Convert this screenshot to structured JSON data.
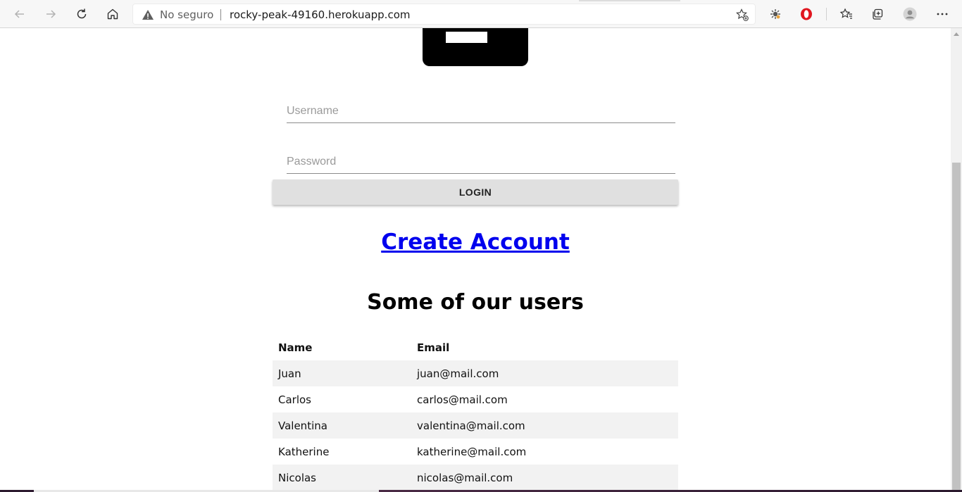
{
  "browser": {
    "security_label": "No seguro",
    "url": "rocky-peak-49160.herokuapp.com",
    "icons": [
      "back-icon",
      "forward-icon",
      "refresh-icon",
      "home-icon",
      "warning-icon",
      "add-favorite-icon",
      "extension-icon",
      "opera-icon",
      "favorites-icon",
      "collections-icon",
      "profile-icon",
      "more-icon"
    ]
  },
  "login": {
    "username_placeholder": "Username",
    "password_placeholder": "Password",
    "button_label": "LOGIN"
  },
  "create_account_label": "Create Account",
  "users_section": {
    "title": "Some of our users",
    "columns": [
      "Name",
      "Email"
    ],
    "rows": [
      {
        "name": "Juan",
        "email": "juan@mail.com"
      },
      {
        "name": "Carlos",
        "email": "carlos@mail.com"
      },
      {
        "name": "Valentina",
        "email": "valentina@mail.com"
      },
      {
        "name": "Katherine",
        "email": "katherine@mail.com"
      },
      {
        "name": "Nicolas",
        "email": "nicolas@mail.com"
      }
    ]
  },
  "colors": {
    "link": "#0000ee",
    "button_bg": "#e0e0e0",
    "row_stripe": "#f2f2f2",
    "logo_bg": "#000000"
  }
}
